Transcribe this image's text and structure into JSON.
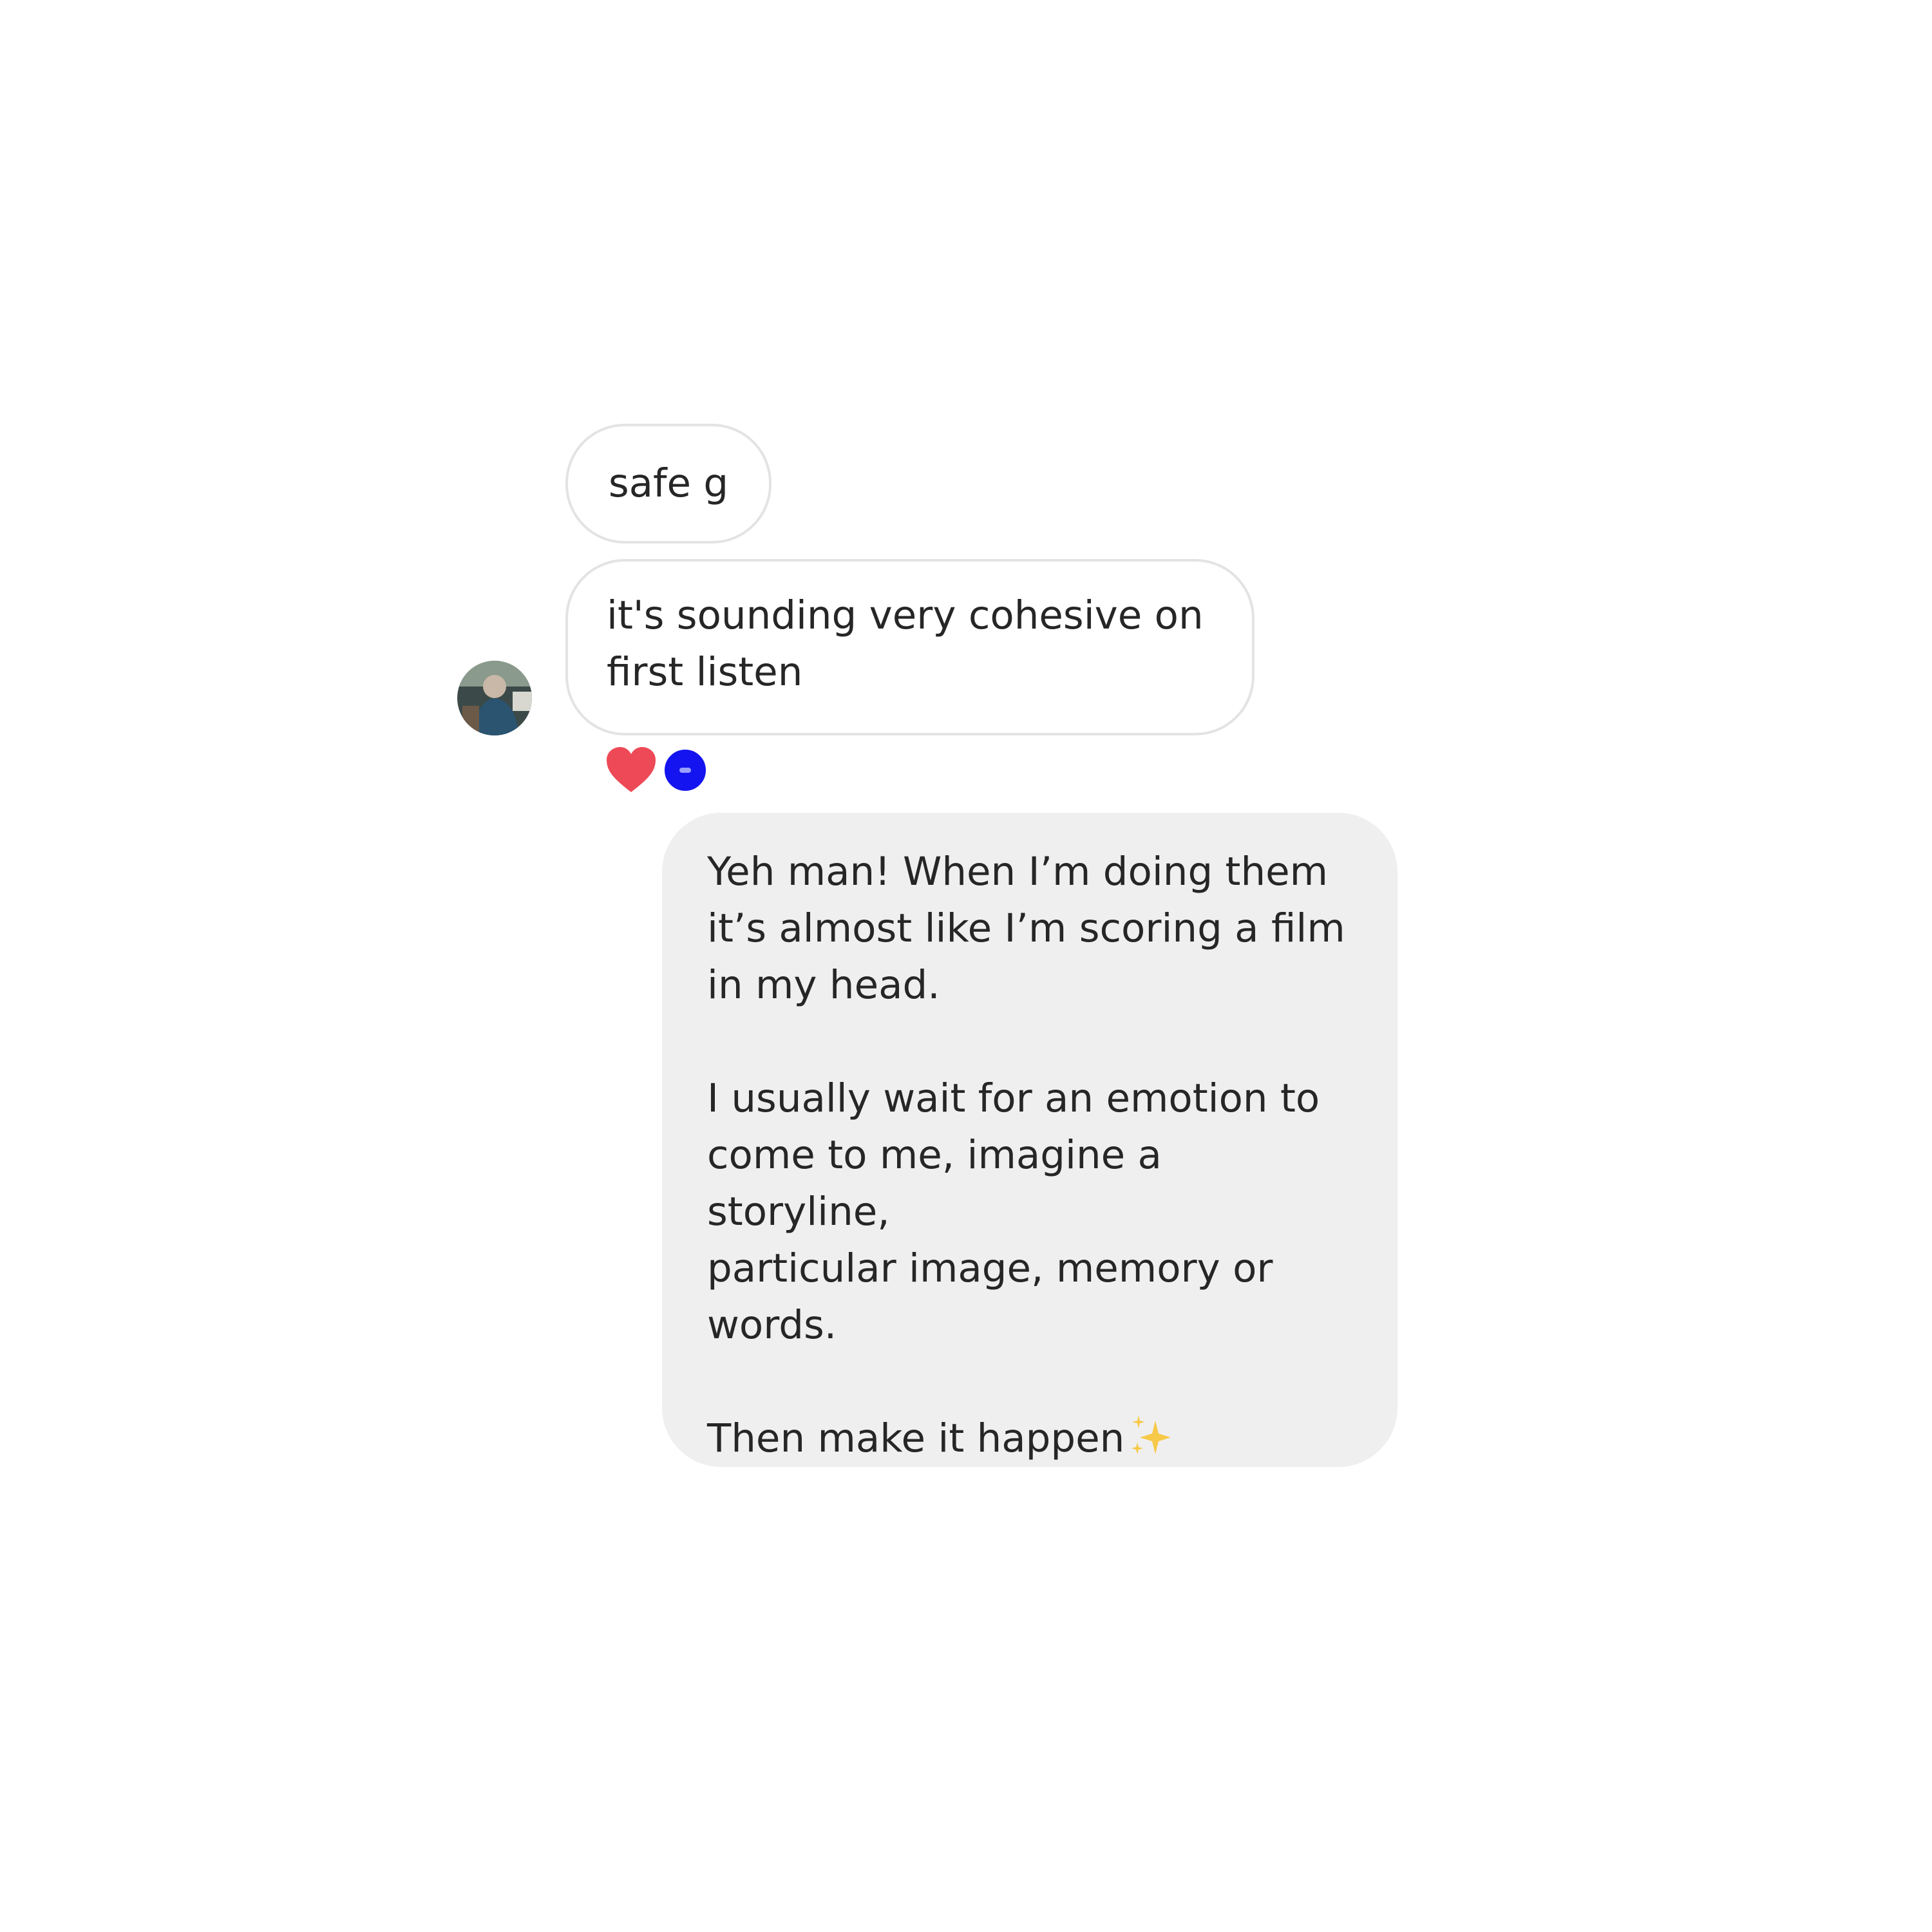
{
  "conversation": {
    "messages": [
      {
        "sender": "other",
        "text": "safe g"
      },
      {
        "sender": "other",
        "text": "it's sounding very cohesive on\nfirst listen",
        "reactions": [
          "heart",
          "user-avatar"
        ]
      },
      {
        "sender": "self",
        "paragraphs": [
          "Yeh man! When I’m doing them\nit’s almost like I’m scoring a film\nin my head.",
          "I usually wait for an emotion to\ncome to me, imagine a storyline,\nparticular image, memory or\nwords.",
          "Then make it happen"
        ],
        "trailing_emoji": "sparkles-icon"
      }
    ]
  },
  "colors": {
    "received_bubble_border": "#e3e3e3",
    "sent_bubble_bg": "#efefef",
    "text": "#262626",
    "heart": "#ed4956",
    "reaction_avatar": "#1414f0",
    "sparkle": "#f7c948"
  }
}
